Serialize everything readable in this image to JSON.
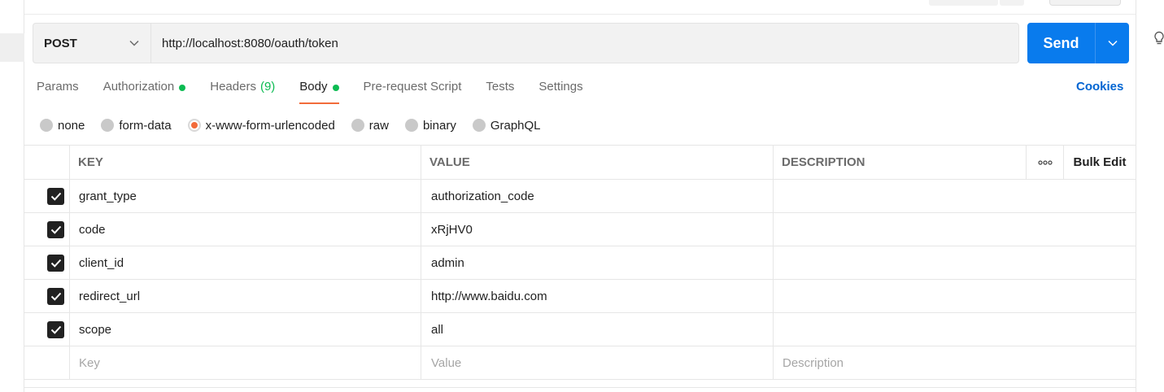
{
  "request": {
    "method": "POST",
    "url": "http://localhost:8080/oauth/token",
    "send_label": "Send"
  },
  "tabs": [
    {
      "label": "Params"
    },
    {
      "label": "Authorization",
      "dot": true
    },
    {
      "label": "Headers",
      "count": "(9)"
    },
    {
      "label": "Body",
      "dot": true,
      "active": true
    },
    {
      "label": "Pre-request Script"
    },
    {
      "label": "Tests"
    },
    {
      "label": "Settings"
    }
  ],
  "cookies_label": "Cookies",
  "body_types": [
    {
      "label": "none"
    },
    {
      "label": "form-data"
    },
    {
      "label": "x-www-form-urlencoded",
      "selected": true
    },
    {
      "label": "raw"
    },
    {
      "label": "binary"
    },
    {
      "label": "GraphQL"
    }
  ],
  "table": {
    "headers": {
      "key": "KEY",
      "value": "VALUE",
      "description": "DESCRIPTION",
      "bulk_edit": "Bulk Edit"
    },
    "rows": [
      {
        "key": "grant_type",
        "value": "authorization_code",
        "description": "",
        "checked": true
      },
      {
        "key": "code",
        "value": "xRjHV0",
        "description": "",
        "checked": true
      },
      {
        "key": "client_id",
        "value": "admin",
        "description": "",
        "checked": true
      },
      {
        "key": "redirect_url",
        "value": "http://www.baidu.com",
        "description": "",
        "checked": true
      },
      {
        "key": "scope",
        "value": "all",
        "description": "",
        "checked": true
      }
    ],
    "placeholders": {
      "key": "Key",
      "value": "Value",
      "description": "Description"
    }
  },
  "colors": {
    "accent": "#f26b3a",
    "send": "#097bed",
    "dot": "#0cbb52",
    "link": "#0265d2"
  }
}
